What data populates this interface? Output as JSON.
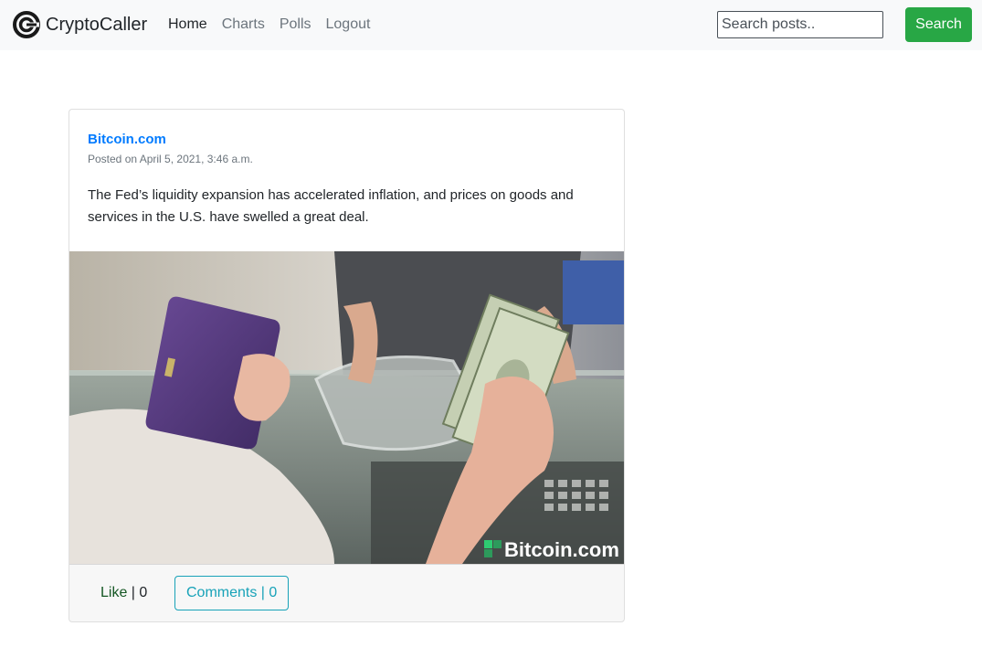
{
  "app": {
    "brand_name": "CryptoCaller",
    "brand_icon": "cryptocaller-logo-icon"
  },
  "nav": {
    "items": [
      {
        "label": "Home",
        "active": true
      },
      {
        "label": "Charts",
        "active": false
      },
      {
        "label": "Polls",
        "active": false
      },
      {
        "label": "Logout",
        "active": false
      }
    ]
  },
  "search": {
    "placeholder": "Search posts..",
    "value": "",
    "button_label": "Search"
  },
  "post": {
    "source": "Bitcoin.com",
    "posted_on": "Posted on April 5, 2021, 3:46 a.m.",
    "text": "The Fed’s liquidity expansion has accelerated inflation, and prices on goods and services in the U.S. have swelled a great deal.",
    "image_watermark": "Bitcoin.com",
    "like_label": "Like",
    "like_separator": " | ",
    "like_count": "0",
    "comments_label": "Comments | 0"
  },
  "colors": {
    "navbar_bg": "#f8f9fa",
    "search_button": "#28a745",
    "link": "#007bff",
    "comments_outline": "#17a2b8"
  }
}
